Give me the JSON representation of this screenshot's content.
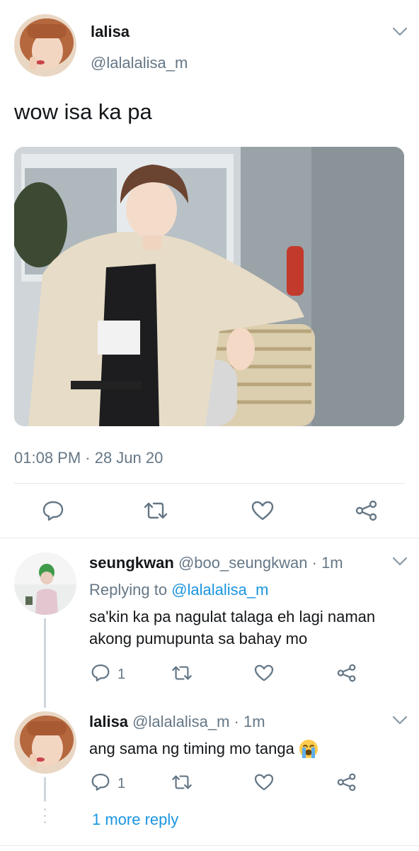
{
  "main_tweet": {
    "author_name": "lalisa",
    "author_handle": "@lalalalisa_m",
    "text": "wow isa ka pa",
    "timestamp": "01:08 PM · 28 Jun 20"
  },
  "replies": [
    {
      "author_name": "seungkwan",
      "meta": "@boo_seungkwan · 1m",
      "replying_prefix": "Replying to",
      "replying_handle": "@lalalalisa_m",
      "text_lines": [
        "sa'kin ka pa nagulat talaga eh lagi naman",
        "akong pumupunta sa bahay mo"
      ],
      "reply_count": "1"
    },
    {
      "author_name": "lalisa",
      "meta": "@lalalalisa_m · 1m",
      "text": "ang sama ng timing mo tanga",
      "emoji": "😭",
      "reply_count": "1"
    }
  ],
  "more_replies_label": "1 more reply",
  "colors": {
    "accent": "#1b95e0",
    "muted": "#657786",
    "divider": "#e1e8ed"
  },
  "icons": [
    "chevron-down-icon",
    "reply-icon",
    "retweet-icon",
    "like-icon",
    "share-icon",
    "crying-face-emoji"
  ]
}
